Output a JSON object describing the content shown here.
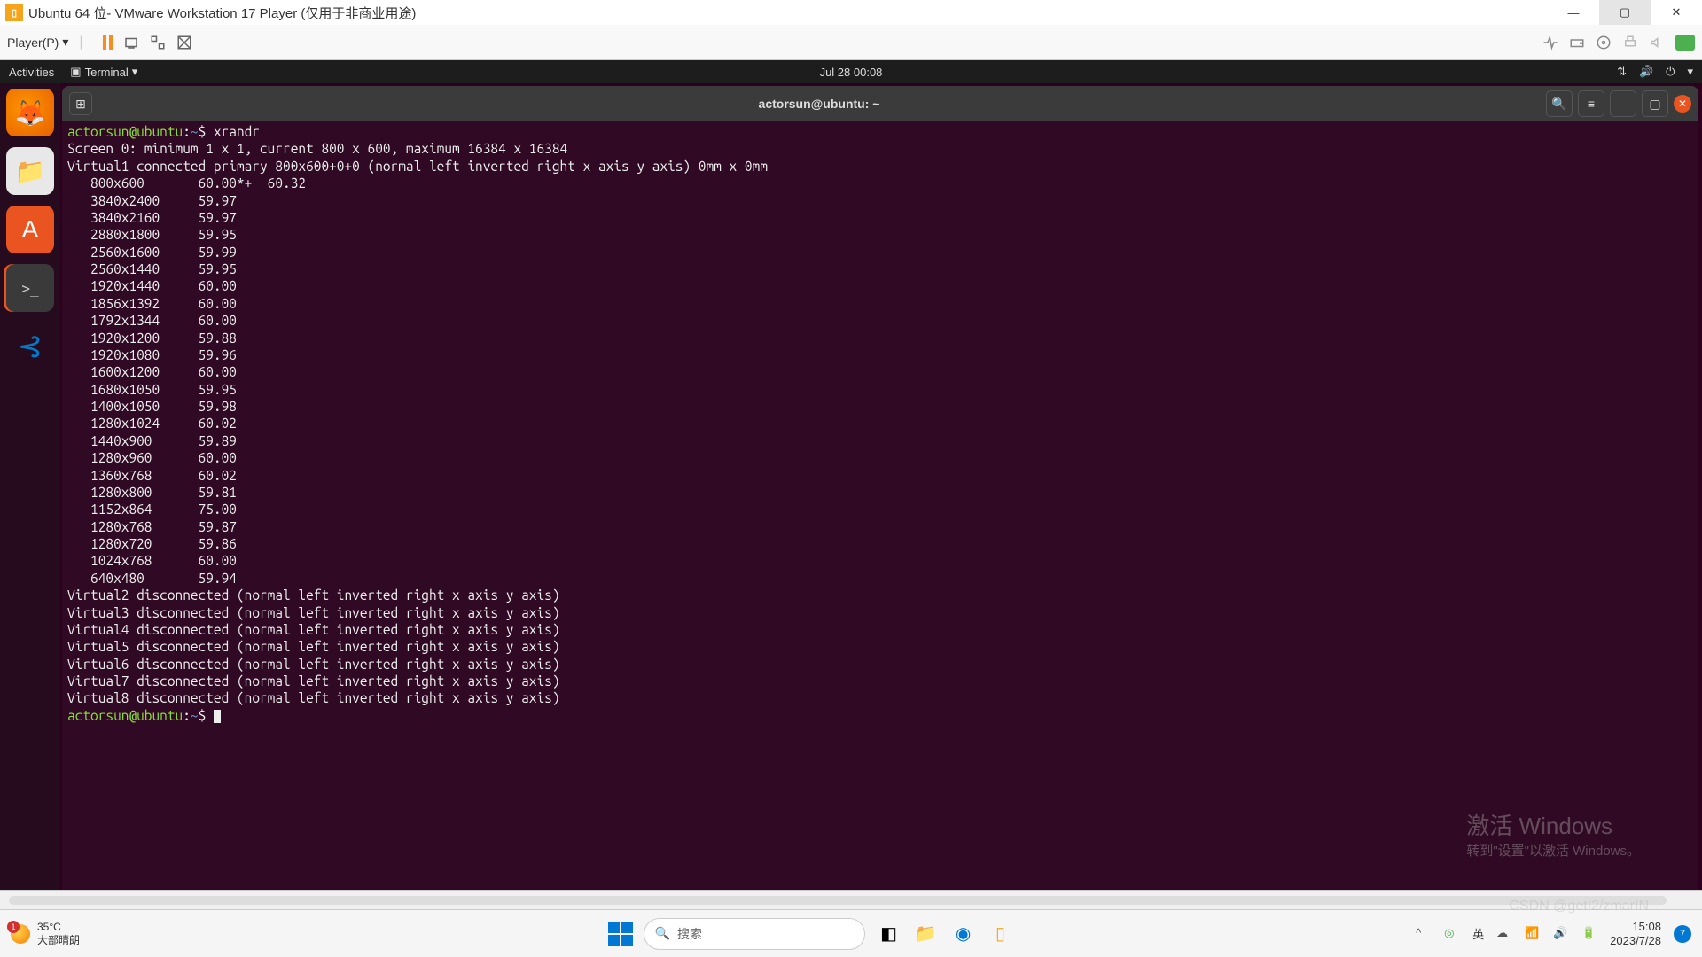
{
  "vmware": {
    "title": "Ubuntu 64 位- VMware Workstation 17 Player (仅用于非商业用途)",
    "player_menu": "Player(P)"
  },
  "ubuntu_top": {
    "activities": "Activities",
    "terminal_label": "Terminal",
    "datetime": "Jul 28  00:08"
  },
  "terminal": {
    "title": "actorsun@ubuntu: ~",
    "prompt_user": "actorsun@ubuntu",
    "prompt_sep": ":",
    "prompt_path": "~",
    "prompt_char": "$",
    "command": "xrandr",
    "screen_line": "Screen 0: minimum 1 x 1, current 800 x 600, maximum 16384 x 16384",
    "virtual1": "Virtual1 connected primary 800x600+0+0 (normal left inverted right x axis y axis) 0mm x 0mm",
    "modes": [
      {
        "res": "800x600",
        "rate": "60.00*+  60.32"
      },
      {
        "res": "3840x2400",
        "rate": "59.97"
      },
      {
        "res": "3840x2160",
        "rate": "59.97"
      },
      {
        "res": "2880x1800",
        "rate": "59.95"
      },
      {
        "res": "2560x1600",
        "rate": "59.99"
      },
      {
        "res": "2560x1440",
        "rate": "59.95"
      },
      {
        "res": "1920x1440",
        "rate": "60.00"
      },
      {
        "res": "1856x1392",
        "rate": "60.00"
      },
      {
        "res": "1792x1344",
        "rate": "60.00"
      },
      {
        "res": "1920x1200",
        "rate": "59.88"
      },
      {
        "res": "1920x1080",
        "rate": "59.96"
      },
      {
        "res": "1600x1200",
        "rate": "60.00"
      },
      {
        "res": "1680x1050",
        "rate": "59.95"
      },
      {
        "res": "1400x1050",
        "rate": "59.98"
      },
      {
        "res": "1280x1024",
        "rate": "60.02"
      },
      {
        "res": "1440x900",
        "rate": "59.89"
      },
      {
        "res": "1280x960",
        "rate": "60.00"
      },
      {
        "res": "1360x768",
        "rate": "60.02"
      },
      {
        "res": "1280x800",
        "rate": "59.81"
      },
      {
        "res": "1152x864",
        "rate": "75.00"
      },
      {
        "res": "1280x768",
        "rate": "59.87"
      },
      {
        "res": "1280x720",
        "rate": "59.86"
      },
      {
        "res": "1024x768",
        "rate": "60.00"
      },
      {
        "res": "640x480",
        "rate": "59.94"
      }
    ],
    "disconnected": [
      "Virtual2 disconnected (normal left inverted right x axis y axis)",
      "Virtual3 disconnected (normal left inverted right x axis y axis)",
      "Virtual4 disconnected (normal left inverted right x axis y axis)",
      "Virtual5 disconnected (normal left inverted right x axis y axis)",
      "Virtual6 disconnected (normal left inverted right x axis y axis)",
      "Virtual7 disconnected (normal left inverted right x axis y axis)",
      "Virtual8 disconnected (normal left inverted right x axis y axis)"
    ]
  },
  "watermark": {
    "line1": "激活 Windows",
    "line2": "转到\"设置\"以激活 Windows。",
    "csdn": "CSDN @getI2/zmarIN"
  },
  "taskbar": {
    "weather_temp": "35°C",
    "weather_desc": "大部晴朗",
    "search_placeholder": "搜索",
    "ime": "英",
    "time": "15:08",
    "date": "2023/7/28",
    "notif_count": "7"
  }
}
